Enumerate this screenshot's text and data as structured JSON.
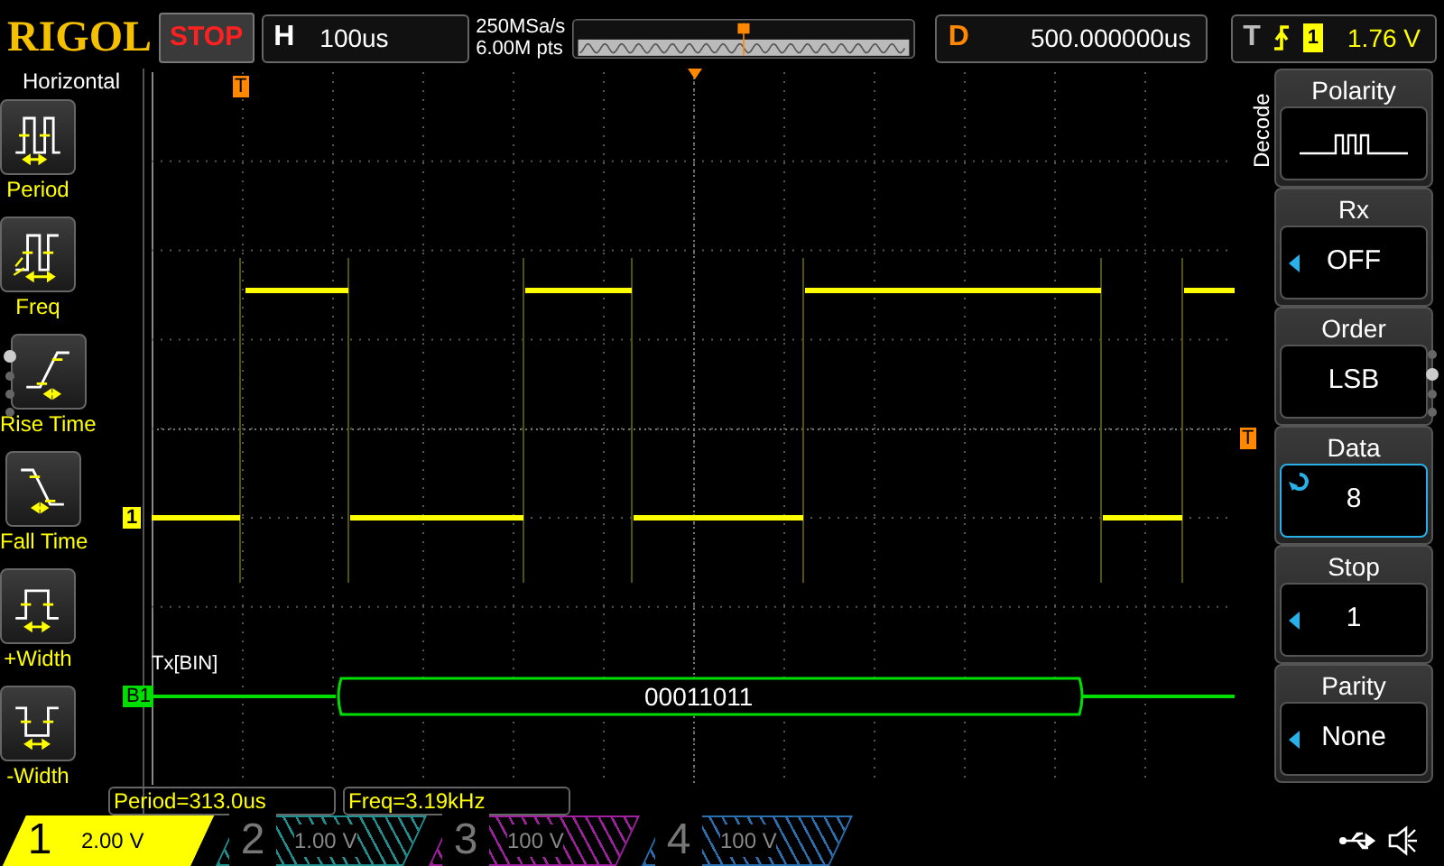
{
  "header": {
    "logo": "RIGOL",
    "run_state": "STOP",
    "timebase": {
      "label": "H",
      "value": "100us"
    },
    "sample_rate": "250MSa/s",
    "memory_depth": "6.00M pts",
    "delay": {
      "label": "D",
      "value": "500.000000us"
    },
    "trigger": {
      "label": "T",
      "source": "1",
      "level": "1.76 V"
    }
  },
  "left_menu": {
    "title": "Horizontal",
    "items": [
      {
        "label": "Period",
        "kind": "period"
      },
      {
        "label": "Freq",
        "kind": "freq"
      },
      {
        "label": "Rise Time",
        "kind": "rise"
      },
      {
        "label": "Fall Time",
        "kind": "fall"
      },
      {
        "label": "+Width",
        "kind": "pwidth"
      },
      {
        "label": "-Width",
        "kind": "nwidth"
      }
    ],
    "pages": [
      {
        "selected": true
      },
      {
        "selected": false
      },
      {
        "selected": false
      },
      {
        "selected": false
      }
    ]
  },
  "plot": {
    "channel_marker": "1",
    "trigger_marker_top": "T",
    "trigger_marker_side": "T",
    "bus_marker": "B1",
    "bus_label": "Tx[BIN]",
    "bus_value": "00011011"
  },
  "measurements": [
    "Period=313.0us",
    "Freq=3.19kHz"
  ],
  "right_menu": {
    "title": "Decode",
    "items": [
      {
        "label": "Polarity",
        "kind": "polarity",
        "selected": false
      },
      {
        "label": "Rx",
        "value": "OFF",
        "kind": "arrow",
        "selected": false
      },
      {
        "label": "Order",
        "value": "LSB",
        "kind": "plain",
        "selected": false
      },
      {
        "label": "Data",
        "value": "8",
        "kind": "knob",
        "selected": true
      },
      {
        "label": "Stop",
        "value": "1",
        "kind": "arrow",
        "selected": false
      },
      {
        "label": "Parity",
        "value": "None",
        "kind": "arrow",
        "selected": false
      }
    ],
    "pages": [
      {
        "selected": false
      },
      {
        "selected": true
      },
      {
        "selected": false
      },
      {
        "selected": false
      }
    ]
  },
  "channels": [
    {
      "number": "1",
      "scale": "2.00 V",
      "selected": true,
      "color": "#ffff00"
    },
    {
      "number": "2",
      "scale": "1.00 V",
      "selected": false,
      "color": "#1f8f8f"
    },
    {
      "number": "3",
      "scale": "100 V",
      "selected": false,
      "color": "#a020a0"
    },
    {
      "number": "4",
      "scale": "100 V",
      "selected": false,
      "color": "#2a6fb0"
    }
  ]
}
